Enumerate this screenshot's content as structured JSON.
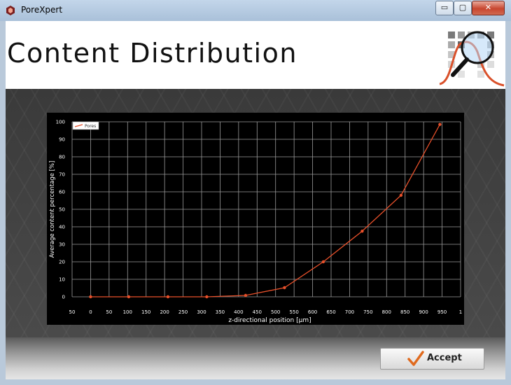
{
  "window": {
    "title": "PoreXpert",
    "controls": {
      "minimize": "▭",
      "maximize": "▢",
      "close": "✕"
    }
  },
  "header": {
    "title": "Content Distribution"
  },
  "footer": {
    "accept_label": "Accept"
  },
  "colors": {
    "series": "#e8502a",
    "chart_bg": "#000000",
    "grid": "#9a9a9a"
  },
  "chart_data": {
    "type": "line",
    "xlabel": "z-directional position [µm]",
    "ylabel": "Average content percentage [%]",
    "xlim": [
      -50,
      1000
    ],
    "ylim": [
      0,
      100
    ],
    "x_ticks": [
      -50,
      0,
      50,
      100,
      150,
      200,
      250,
      300,
      350,
      400,
      450,
      500,
      550,
      600,
      650,
      700,
      750,
      800,
      850,
      900,
      950,
      1000
    ],
    "x_tick_labels": [
      "50",
      "0",
      "50",
      "100",
      "150",
      "200",
      "250",
      "300",
      "350",
      "400",
      "450",
      "500",
      "550",
      "600",
      "650",
      "700",
      "750",
      "800",
      "850",
      "900",
      "950",
      "1"
    ],
    "y_ticks": [
      0,
      10,
      20,
      30,
      40,
      50,
      60,
      70,
      80,
      90,
      100
    ],
    "y_tick_labels": [
      "0",
      "10",
      "20",
      "30",
      "40",
      "50",
      "60",
      "70",
      "80",
      "90",
      "100"
    ],
    "grid": true,
    "legend": "top-left",
    "series": [
      {
        "name": "Pores",
        "x": [
          0,
          103,
          209,
          314,
          419,
          524,
          629,
          734,
          839,
          944
        ],
        "y": [
          0,
          0,
          0,
          0,
          0.8,
          5.2,
          20,
          37.5,
          58,
          98.5
        ]
      }
    ]
  }
}
